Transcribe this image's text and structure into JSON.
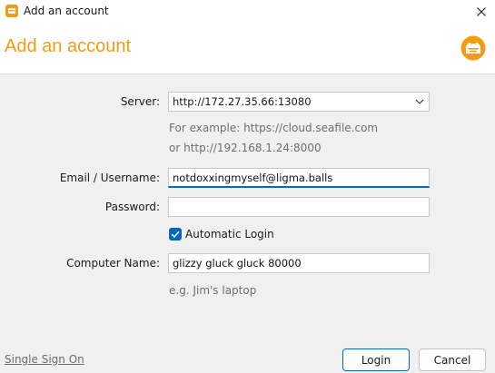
{
  "window": {
    "title": "Add an account",
    "close_icon": "close-icon"
  },
  "header": {
    "title": "Add an account",
    "logo_icon": "seafile-logo-icon",
    "accent_color": "#f39c12"
  },
  "form": {
    "server": {
      "label": "Server:",
      "value": "http://172.27.35.66:13080",
      "hint_line1": "For example: https://cloud.seafile.com",
      "hint_line2": "or http://192.168.1.24:8000"
    },
    "email": {
      "label": "Email / Username:",
      "value": "notdoxxingmyself@ligma.balls"
    },
    "password": {
      "label": "Password:",
      "value": ""
    },
    "auto_login": {
      "label": "Automatic Login",
      "checked": true
    },
    "computer_name": {
      "label": "Computer Name:",
      "value": "glizzy gluck gluck 80000",
      "hint": "e.g. Jim's laptop"
    }
  },
  "footer": {
    "sso_label": "Single Sign On",
    "login_label": "Login",
    "cancel_label": "Cancel"
  },
  "colors": {
    "focus_blue": "#0067c0"
  }
}
